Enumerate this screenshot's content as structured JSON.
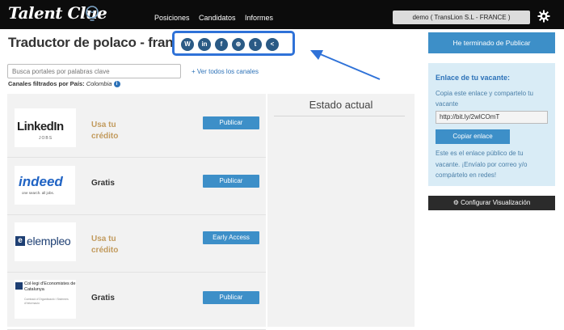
{
  "header": {
    "logo_text": "Talent Clue",
    "nav": [
      "Posiciones",
      "Candidatos",
      "Informes"
    ],
    "account": "demo ( TransLion S.L - FRANCE )"
  },
  "page": {
    "title": "Traductor de polaco - francés",
    "share_icons": [
      {
        "icon": "wordpress-icon",
        "glyph": "W"
      },
      {
        "icon": "linkedin-icon",
        "glyph": "in"
      },
      {
        "icon": "facebook-icon",
        "glyph": "f"
      },
      {
        "icon": "globe-icon",
        "glyph": "⊕"
      },
      {
        "icon": "twitter-icon",
        "glyph": "t"
      },
      {
        "icon": "share-icon",
        "glyph": "<"
      }
    ]
  },
  "search": {
    "placeholder": "Busca portales por palabras clave",
    "see_all": "+ Ver todos los canales",
    "filter_label": "Canales filtrados por País:",
    "filter_value": "Colombia"
  },
  "channels": [
    {
      "name": "LinkedIn",
      "sub": "JOBS",
      "price": "Usa tu crédito",
      "price_color": "#c29b5e",
      "button": "Publicar"
    },
    {
      "name": "indeed",
      "sub": "one search. all jobs.",
      "price": "Gratis",
      "price_color": "#333333",
      "button": "Publicar"
    },
    {
      "name": "elempleo",
      "sub": "",
      "price": "Usa tu crédito",
      "price_color": "#c29b5e",
      "button": "Early Access"
    },
    {
      "name": "Col·legi d'Economistes de Catalunya",
      "sub": "Comissió d'Organització i Sistemes d'Informació",
      "price": "Gratis",
      "price_color": "#333333",
      "button": "Publicar"
    }
  ],
  "estado": {
    "title": "Estado actual"
  },
  "sidebar": {
    "done_button": "He terminado de Publicar",
    "link_title": "Enlace de tu vacante:",
    "link_desc": "Copia este enlace y compartelo tu vacante",
    "link_value": "http://bit.ly/2wlCOmT",
    "copy_button": "Copiar enlace",
    "link_note": "Este es el enlace público de tu vacante. ¡Envíalo por correo y/o compártelo en redes!",
    "config_button": "Configurar Visualización"
  },
  "colors": {
    "accent": "#3d8fc8",
    "highlight_border": "#2f72d8",
    "topbar": "#0c0c0c"
  }
}
